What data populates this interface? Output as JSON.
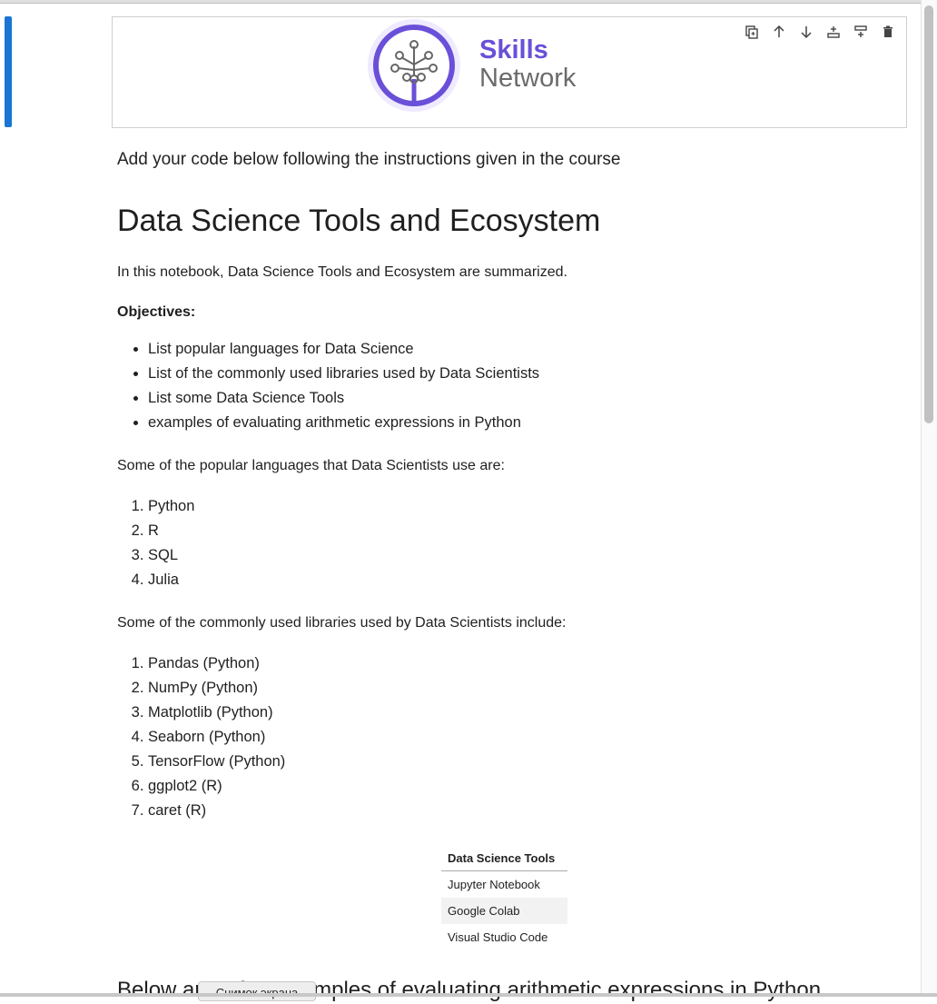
{
  "logo": {
    "line1": "Skills",
    "line2": "Network"
  },
  "toolbar": {
    "icons": [
      "duplicate-icon",
      "move-up-icon",
      "move-down-icon",
      "insert-below-icon",
      "insert-above-icon",
      "delete-icon"
    ]
  },
  "notebook": {
    "instruction": "Add your code below following the instructions given in the course",
    "title": "Data Science Tools and Ecosystem",
    "intro": "In this notebook, Data Science Tools and Ecosystem are summarized.",
    "objectives_label": "Objectives:",
    "objectives": [
      "List popular languages for Data Science",
      "List of the commonly used libraries used by Data Scientists",
      "List some Data Science Tools",
      "examples of evaluating arithmetic expressions in Python"
    ],
    "languages_intro": "Some of the popular languages that Data Scientists use are:",
    "languages": [
      "Python",
      "R",
      "SQL",
      "Julia"
    ],
    "libraries_intro": "Some of the commonly used libraries used by Data Scientists include:",
    "libraries": [
      "Pandas (Python)",
      "NumPy (Python)",
      "Matplotlib (Python)",
      "Seaborn (Python)",
      "TensorFlow (Python)",
      "ggplot2 (R)",
      "caret (R)"
    ],
    "tools_table": {
      "header": "Data Science Tools",
      "rows": [
        "Jupyter Notebook",
        "Google Colab",
        "Visual Studio Code"
      ]
    },
    "next_heading": "Below are a few examples of evaluating arithmetic expressions in Python"
  },
  "tooltip": "Снимок экрана",
  "colors": {
    "accent": "#1976d2",
    "brand": "#6a4fd8"
  }
}
